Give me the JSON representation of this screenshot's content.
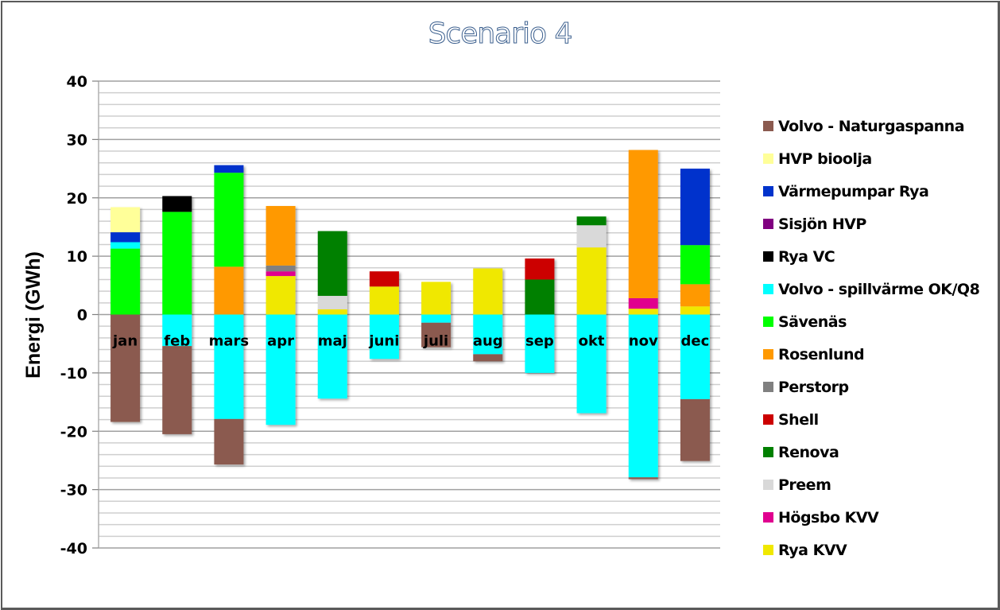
{
  "chart_data": {
    "type": "bar",
    "stacked": true,
    "title": "Scenario 4",
    "xlabel": "",
    "ylabel": "Energi (GWh)",
    "ylim": [
      -40,
      40
    ],
    "yticks": [
      40,
      30,
      20,
      10,
      0,
      -10,
      -20,
      -30,
      -40
    ],
    "ytick_labels": [
      "40",
      "30",
      "20",
      "10",
      "0",
      "-10",
      "-20",
      "-30",
      "-40"
    ],
    "minor_grid_step": 2,
    "grid": true,
    "legend_position": "right",
    "categories": [
      "jan",
      "feb",
      "mars",
      "apr",
      "maj",
      "juni",
      "juli",
      "aug",
      "sep",
      "okt",
      "nov",
      "dec"
    ],
    "series": [
      {
        "name": "Volvo - Naturgaspanna",
        "color": "#8B5A4F",
        "values": [
          -18.4,
          -15.1,
          -7.8,
          0,
          0,
          0,
          -4.2,
          -1.2,
          0,
          0,
          -0.3,
          -10.6
        ]
      },
      {
        "name": "HVP bioolja",
        "color": "#FFFF99",
        "values": [
          4.3,
          0,
          0,
          0,
          0,
          0,
          0,
          0,
          0,
          0,
          0,
          0
        ]
      },
      {
        "name": "Värmepumpar Rya",
        "color": "#0033CC",
        "values": [
          1.7,
          0,
          1.3,
          0,
          0,
          0,
          0,
          0,
          0,
          0,
          0,
          13.1
        ]
      },
      {
        "name": "Sisjön HVP",
        "color": "#800080",
        "values": [
          0,
          0,
          0,
          0,
          0,
          0,
          0,
          0,
          0,
          0,
          0,
          0
        ]
      },
      {
        "name": "Rya VC",
        "color": "#000000",
        "values": [
          0,
          2.7,
          0,
          0,
          0,
          0,
          0,
          0,
          0,
          0,
          0,
          0
        ]
      },
      {
        "name": "Volvo - spillvärme OK/Q8",
        "color": "#00FFFF",
        "values": [
          1.1,
          -5.4,
          -17.9,
          -18.9,
          -14.4,
          -7.6,
          -1.4,
          -6.8,
          -10.0,
          -16.9,
          -27.9,
          -14.5
        ]
      },
      {
        "name": "Sävenäs",
        "color": "#00FF00",
        "values": [
          11.3,
          17.6,
          16.1,
          0,
          0,
          0,
          0,
          0,
          0,
          0,
          0,
          6.7
        ]
      },
      {
        "name": "Rosenlund",
        "color": "#FF9900",
        "values": [
          0,
          0,
          8.2,
          10.2,
          0,
          0,
          0,
          0,
          0,
          0,
          25.4,
          3.8
        ]
      },
      {
        "name": "Perstorp",
        "color": "#808080",
        "values": [
          0,
          0,
          0,
          1.0,
          0,
          0,
          0,
          0,
          0,
          0,
          0,
          0
        ]
      },
      {
        "name": "Shell",
        "color": "#CC0000",
        "values": [
          0,
          0,
          0,
          0,
          0,
          2.6,
          0,
          0,
          3.6,
          0,
          0,
          0
        ]
      },
      {
        "name": "Renova",
        "color": "#008000",
        "values": [
          0,
          0,
          0,
          0,
          11.1,
          0,
          0,
          0,
          6.0,
          1.5,
          0,
          0
        ]
      },
      {
        "name": "Preem",
        "color": "#D9D9D9",
        "values": [
          0,
          0,
          0,
          0,
          2.3,
          0,
          0,
          0,
          0,
          3.8,
          0,
          0
        ]
      },
      {
        "name": "Högsbo KVV",
        "color": "#E0008F",
        "values": [
          0,
          0,
          0,
          0.8,
          0,
          0,
          0,
          0,
          0,
          0,
          1.8,
          0
        ]
      },
      {
        "name": "Rya KVV",
        "color": "#F0E800",
        "values": [
          0,
          0,
          0,
          6.6,
          0.9,
          4.8,
          5.6,
          7.9,
          0,
          11.5,
          1.0,
          1.4
        ]
      }
    ],
    "stack_order_positive": [
      "Rya KVV",
      "Högsbo KVV",
      "Preem",
      "Renova",
      "Shell",
      "Perstorp",
      "Rosenlund",
      "Sävenäs",
      "Volvo - spillvärme OK/Q8",
      "Rya VC",
      "Sisjön HVP",
      "Värmepumpar Rya",
      "HVP bioolja",
      "Volvo - Naturgaspanna"
    ],
    "stack_order_negative": [
      "Volvo - spillvärme OK/Q8",
      "Volvo - Naturgaspanna"
    ]
  }
}
